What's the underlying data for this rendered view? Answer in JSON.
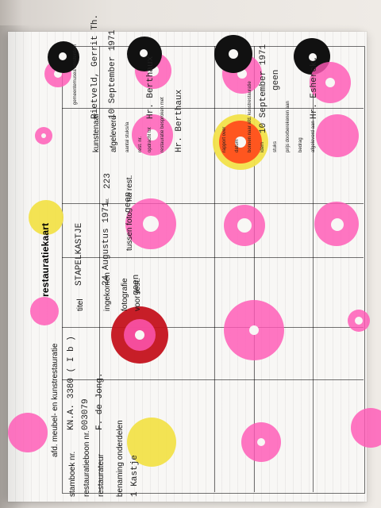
{
  "form": {
    "title": "restauratiekaart",
    "section": "afd. meubel- en kunstrestauratie",
    "labels": {
      "stamboek": "stamboek nr.",
      "restauratieboon": "restauratieboon nr.",
      "restaurateur": "restaurateur",
      "benaming": "benaming onderdelen",
      "titel": "titel",
      "ingekomen": "ingekomen",
      "nr": "nr.",
      "fotografie": "fotografie",
      "voor_rest": "voor rest.",
      "tussen_foto": "tussen foto",
      "na_rest": "na rest.",
      "kunstenaar": "kunstenaar",
      "afgeleverd": "afgeleverd",
      "aantal_stuk": "aantal stuks/ia",
      "rest_nr": "rest. nr.",
      "opdracht_tot": "opdracht tot",
      "rapport_met": "restauratie besproken met",
      "gemeentemusea": "gemeentemusea amsterdam",
      "rapport_over": "rapport over",
      "datum": "datum",
      "bonnen": "bonnen naar afd. kunstrestauratie",
      "idem": "idem",
      "stuks": "stuks",
      "prijs": "prijs doorberekenen aan",
      "bedrag": "bedrag",
      "afgeleverd_aan": "afgeleverd aan"
    },
    "values": {
      "stamboek": "KN.A. 3380   ( I b )",
      "restauratieboon": "003079",
      "restaurateur": "F. de Jong.",
      "benaming_item": "1  Kastje",
      "titel": "STAPELKASTJE",
      "ingekomen": "24 Augustus 1971",
      "nr": "223",
      "tussen_foto": "geen",
      "voor_rest": "geen",
      "kunstenaar": "Rietveld, Gerrit Th.",
      "afgeleverd": "10 September 1971",
      "opdracht": "Hr. Berthaux",
      "besproken": "Hr. Berthaux",
      "datum": "10 September 1971",
      "stuks": "geen",
      "afgeleverd_aan": "Hr. Esherck."
    }
  }
}
